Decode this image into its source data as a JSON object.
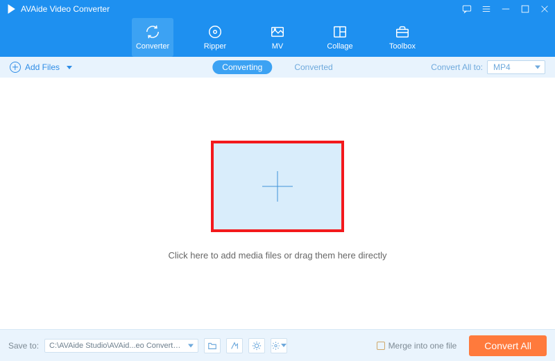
{
  "app": {
    "title": "AVAide Video Converter"
  },
  "nav": {
    "items": [
      {
        "label": "Converter"
      },
      {
        "label": "Ripper"
      },
      {
        "label": "MV"
      },
      {
        "label": "Collage"
      },
      {
        "label": "Toolbox"
      }
    ]
  },
  "subbar": {
    "add_files": "Add Files",
    "tabs": {
      "converting": "Converting",
      "converted": "Converted"
    },
    "convert_all_label": "Convert All to:",
    "format": "MP4"
  },
  "content": {
    "hint": "Click here to add media files or drag them here directly"
  },
  "footer": {
    "save_to": "Save to:",
    "path": "C:\\AVAide Studio\\AVAid...eo Converter\\Converted",
    "merge": "Merge into one file",
    "convert_all": "Convert All"
  }
}
